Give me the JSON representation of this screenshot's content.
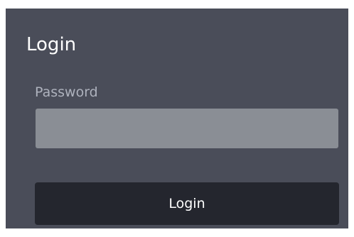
{
  "login_panel": {
    "title": "Login",
    "password_label": "Password",
    "password_value": "",
    "password_placeholder": "",
    "submit_label": "Login"
  },
  "colors": {
    "panel_background": "#4a4d59",
    "title_text": "#ffffff",
    "label_text": "#aeb2bd",
    "input_background": "#8a8e95",
    "button_background": "#24262e",
    "button_text": "#ffffff"
  }
}
